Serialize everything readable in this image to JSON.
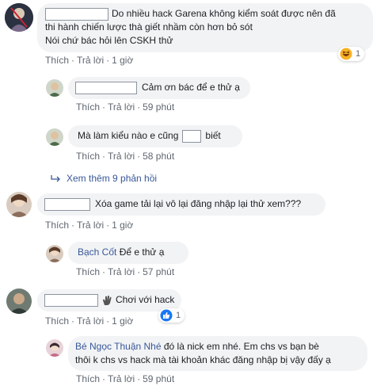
{
  "comments": [
    {
      "lines": [
        "Do nhiều hack Garena không kiểm soát được nên đã",
        "thi hành chiến lược thà giết nhầm còn hơn bỏ sót",
        "Nói chứ bác hỏi lên CSKH thử"
      ],
      "like": "Thích",
      "reply": "Trả lời",
      "time": "1 giờ",
      "reaction": {
        "icon": "haha-emoji-icon",
        "count": "1"
      }
    },
    {
      "text": "Cảm ơn bác để e thử ạ",
      "like": "Thích",
      "reply": "Trả lời",
      "time": "59 phút"
    },
    {
      "text_before": "Mà làm kiểu nào e cũng",
      "text_after": "biết",
      "like": "Thích",
      "reply": "Trả lời",
      "time": "58 phút"
    },
    {
      "more_replies": "Xem thêm 9 phản hồi"
    },
    {
      "text": "Xóa game tải lại vô lại đăng nhập lại thử xem???",
      "like": "Thích",
      "reply": "Trả lời",
      "time": "1 giờ"
    },
    {
      "author": "Bạch Cốt",
      "text": "Để e thử ạ",
      "like": "Thích",
      "reply": "Trả lời",
      "time": "57 phút"
    },
    {
      "text": "Chơi với hack",
      "like": "Thích",
      "reply": "Trả lời",
      "time": "1 giờ",
      "reaction": {
        "icon": "like-reaction-icon",
        "count": "1"
      }
    },
    {
      "author": "Bé Ngọc Thuận Nhé",
      "lines": [
        "đó là nick em nhé. Em chs vs bạn bè",
        "thôi k chs vs hack mà tài khoản khác đăng nhập bị vậy đấy ạ"
      ],
      "like": "Thích",
      "reply": "Trả lời",
      "time": "59 phút"
    }
  ],
  "colors": {
    "bubble": "#f2f3f5",
    "link": "#385898",
    "meta": "#606770",
    "text": "#1c1e21"
  }
}
